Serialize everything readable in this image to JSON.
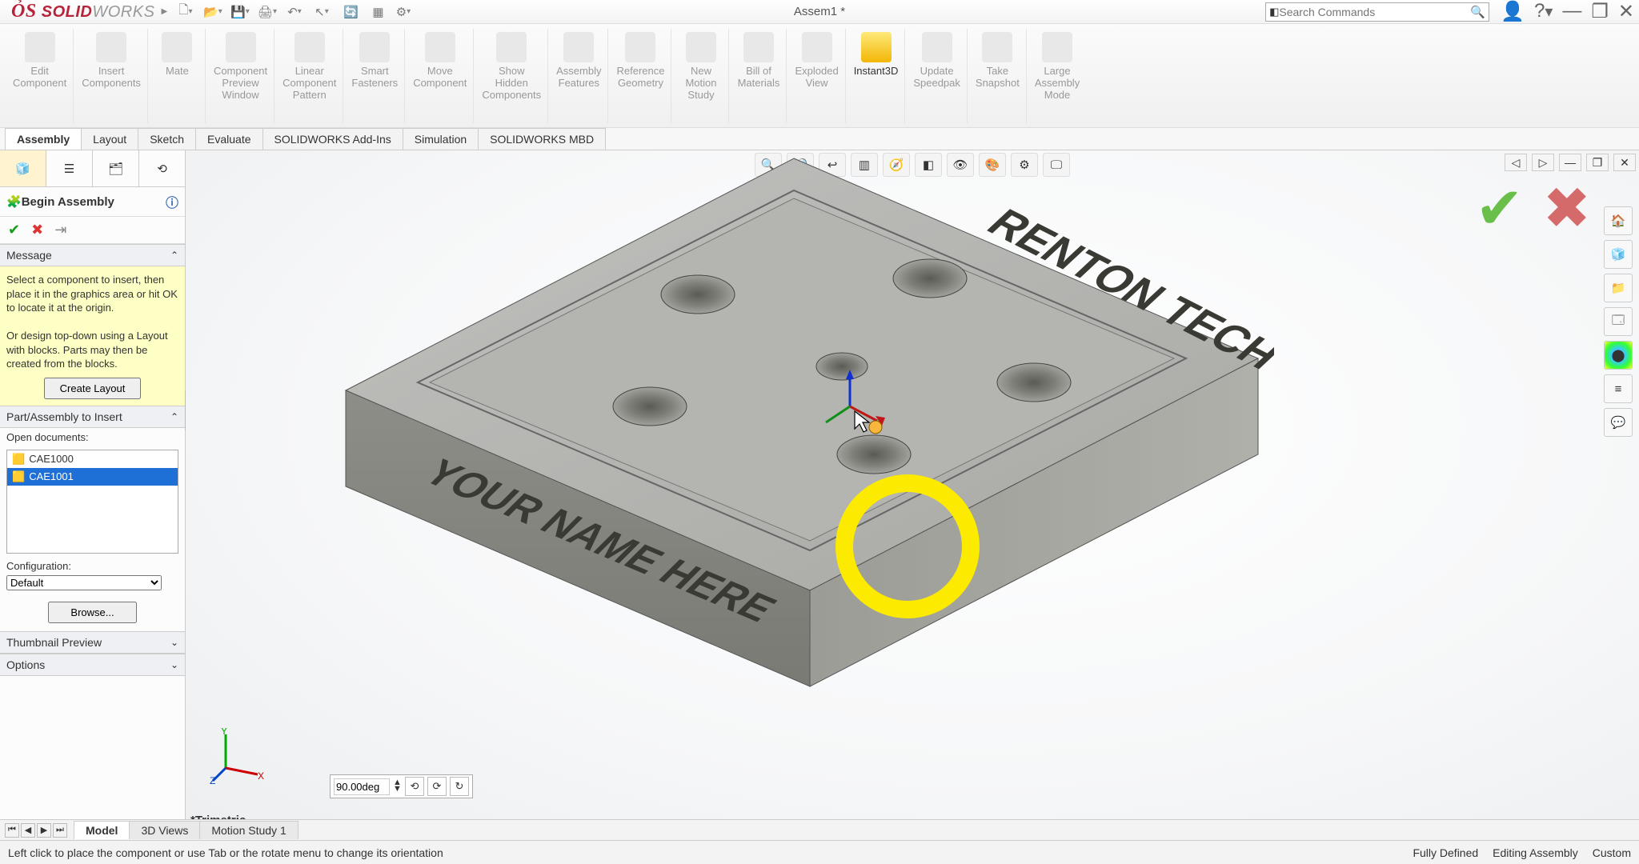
{
  "app": {
    "logo_prefix": "SOLID",
    "logo_suffix": "WORKS",
    "doc_title": "Assem1 *",
    "search_placeholder": "Search Commands"
  },
  "qat": [
    "home-icon",
    "new-icon",
    "open-icon",
    "save-icon",
    "print-icon",
    "undo-icon",
    "redo-icon",
    "select-icon",
    "rebuild-icon",
    "options-icon",
    "settings-icon"
  ],
  "ribbon": [
    {
      "label": "Edit\nComponent",
      "active": false
    },
    {
      "label": "Insert\nComponents",
      "active": false
    },
    {
      "label": "Mate",
      "active": false
    },
    {
      "label": "Component\nPreview\nWindow",
      "active": false
    },
    {
      "label": "Linear\nComponent\nPattern",
      "active": false
    },
    {
      "label": "Smart\nFasteners",
      "active": false
    },
    {
      "label": "Move\nComponent",
      "active": false
    },
    {
      "label": "Show\nHidden\nComponents",
      "active": false
    },
    {
      "label": "Assembly\nFeatures",
      "active": false
    },
    {
      "label": "Reference\nGeometry",
      "active": false
    },
    {
      "label": "New\nMotion\nStudy",
      "active": false
    },
    {
      "label": "Bill of\nMaterials",
      "active": false
    },
    {
      "label": "Exploded\nView",
      "active": false
    },
    {
      "label": "Instant3D",
      "active": true
    },
    {
      "label": "Update\nSpeedpak",
      "active": false
    },
    {
      "label": "Take\nSnapshot",
      "active": false
    },
    {
      "label": "Large\nAssembly\nMode",
      "active": false
    }
  ],
  "cmdtabs": [
    "Assembly",
    "Layout",
    "Sketch",
    "Evaluate",
    "SOLIDWORKS Add-Ins",
    "Simulation",
    "SOLIDWORKS MBD"
  ],
  "cmdtab_active": "Assembly",
  "pm": {
    "title": "Begin Assembly",
    "msg_head": "Message",
    "msg1": "Select a component to insert, then place it in the graphics area or hit OK to locate it at the origin.",
    "msg2": "Or design top-down using a Layout with blocks. Parts may then be created from the blocks.",
    "create_layout": "Create Layout",
    "part_head": "Part/Assembly to Insert",
    "open_docs": "Open documents:",
    "docs": [
      {
        "name": "CAE1000",
        "sel": false
      },
      {
        "name": "CAE1001",
        "sel": true
      }
    ],
    "cfg_label": "Configuration:",
    "cfg_value": "Default",
    "browse": "Browse...",
    "thumb_head": "Thumbnail Preview",
    "opt_head": "Options"
  },
  "viewport": {
    "view_label": "*Trimetric",
    "rot_value": "90.00deg",
    "engrave_top": "RENTON TECH",
    "engrave_front": "YOUR NAME HERE"
  },
  "bottom_tabs": [
    "Model",
    "3D Views",
    "Motion Study 1"
  ],
  "bottom_active": "Model",
  "status": {
    "left": "Left click to place the component or use Tab or the rotate menu to change its orientation",
    "r1": "Fully Defined",
    "r2": "Editing Assembly",
    "r3": "Custom"
  }
}
